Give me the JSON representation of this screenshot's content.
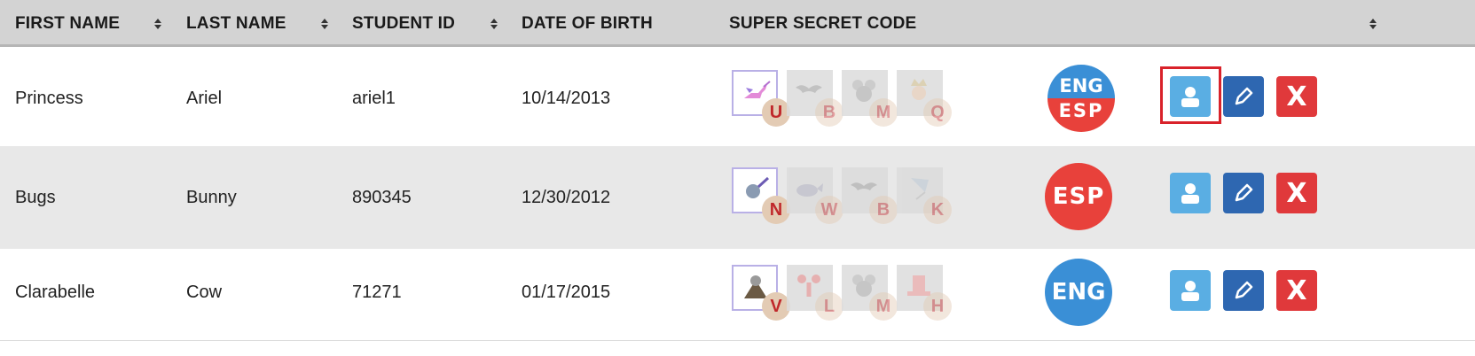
{
  "columns": {
    "first_name": "FIRST NAME",
    "last_name": "LAST NAME",
    "student_id": "STUDENT ID",
    "date_of_birth": "DATE OF BIRTH",
    "super_secret_code": "SUPER SECRET CODE"
  },
  "rows": [
    {
      "first_name": "Princess",
      "last_name": "Ariel",
      "student_id": "ariel1",
      "dob": "10/14/2013",
      "code": [
        {
          "letter": "U",
          "icon": "unicorn-icon"
        },
        {
          "letter": "B",
          "icon": "bat-icon"
        },
        {
          "letter": "M",
          "icon": "mouse-icon"
        },
        {
          "letter": "Q",
          "icon": "queen-icon"
        }
      ],
      "language": {
        "top": "ENG",
        "bottom": "ESP"
      }
    },
    {
      "first_name": "Bugs",
      "last_name": "Bunny",
      "student_id": "890345",
      "dob": "12/30/2012",
      "code": [
        {
          "letter": "N",
          "icon": "net-icon"
        },
        {
          "letter": "W",
          "icon": "whale-icon"
        },
        {
          "letter": "B",
          "icon": "bat-icon"
        },
        {
          "letter": "K",
          "icon": "kite-icon"
        }
      ],
      "language": {
        "label": "ESP"
      }
    },
    {
      "first_name": "Clarabelle",
      "last_name": "Cow",
      "student_id": "71271",
      "dob": "01/17/2015",
      "code": [
        {
          "letter": "V",
          "icon": "volcano-icon"
        },
        {
          "letter": "L",
          "icon": "lobster-icon"
        },
        {
          "letter": "M",
          "icon": "mouse-icon"
        },
        {
          "letter": "H",
          "icon": "hat-icon"
        }
      ],
      "language": {
        "label": "ENG"
      }
    }
  ],
  "colors": {
    "header_bg": "#d3d3d3",
    "alt_row_bg": "#e8e8e8",
    "eng_blue": "#3a8fd6",
    "esp_red": "#e8413b",
    "profile_button": "#5aaee3",
    "edit_button": "#2e67b1",
    "delete_button": "#e0393b",
    "highlight": "#d9222a"
  },
  "actions": {
    "delete_label": "X"
  }
}
